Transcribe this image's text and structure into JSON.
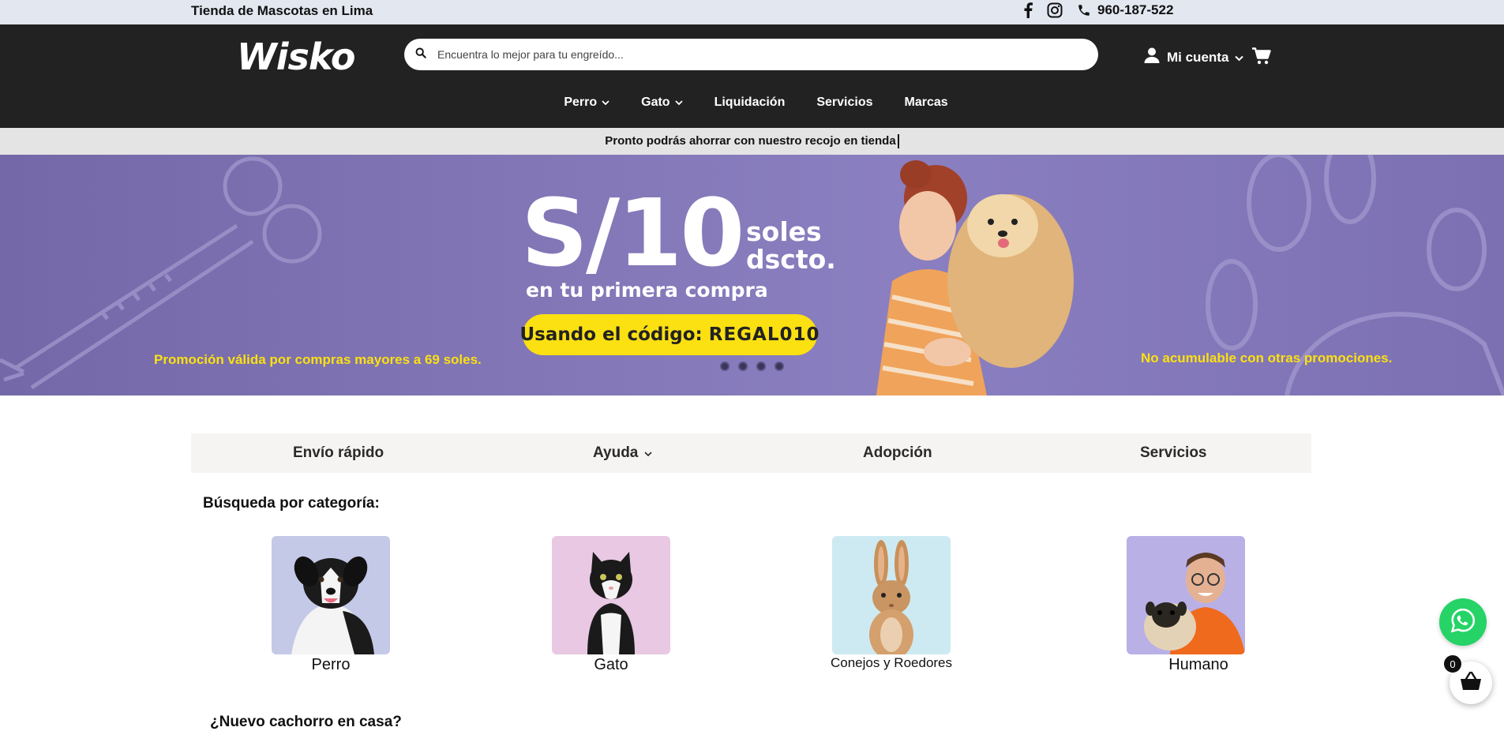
{
  "topbar": {
    "store_title": "Tienda de Mascotas en Lima",
    "phone": "960-187-522"
  },
  "header": {
    "logo_text": "Wisko",
    "search_placeholder": "Encuentra lo mejor para tu engreído...",
    "account_label": "Mi cuenta"
  },
  "nav": {
    "items": [
      {
        "label": "Perro",
        "dropdown": true
      },
      {
        "label": "Gato",
        "dropdown": true
      },
      {
        "label": "Liquidación",
        "dropdown": false
      },
      {
        "label": "Servicios",
        "dropdown": false
      },
      {
        "label": "Marcas",
        "dropdown": false
      }
    ]
  },
  "announcement": "Pronto podrás ahorrar con nuestro recojo en tienda",
  "hero": {
    "amount": "S/10",
    "soles_line1": "soles",
    "soles_line2": "dscto.",
    "subtitle": "en tu primera compra",
    "coupon_prefix": "Usando el código: ",
    "coupon_code": "REGAL010",
    "promo_left": "Promoción válida por compras mayores a 69 soles.",
    "promo_right": "No acumulable con otras promociones.",
    "slide_count": 4
  },
  "infobar": {
    "items": [
      {
        "label": "Envío rápido"
      },
      {
        "label": "Ayuda"
      },
      {
        "label": "Adopción"
      },
      {
        "label": "Servicios"
      }
    ]
  },
  "categories": {
    "title": "Búsqueda por categoría:",
    "items": [
      {
        "label": "Perro",
        "bg": "#c5c9e8"
      },
      {
        "label": "Gato",
        "bg": "#e8c8e3"
      },
      {
        "label": "Conejos y Roedores",
        "bg": "#cdeaf2"
      },
      {
        "label": "Humano",
        "bg": "#b9b0e6"
      }
    ]
  },
  "next_section_title": "¿Nuevo cachorro en casa?",
  "cart": {
    "count": "0"
  },
  "colors": {
    "header_bg": "#222222",
    "topbar_bg": "#e3e7f0",
    "hero_bg": "#8478b8",
    "accent_yellow": "#fbe012",
    "whatsapp_green": "#25d366"
  }
}
